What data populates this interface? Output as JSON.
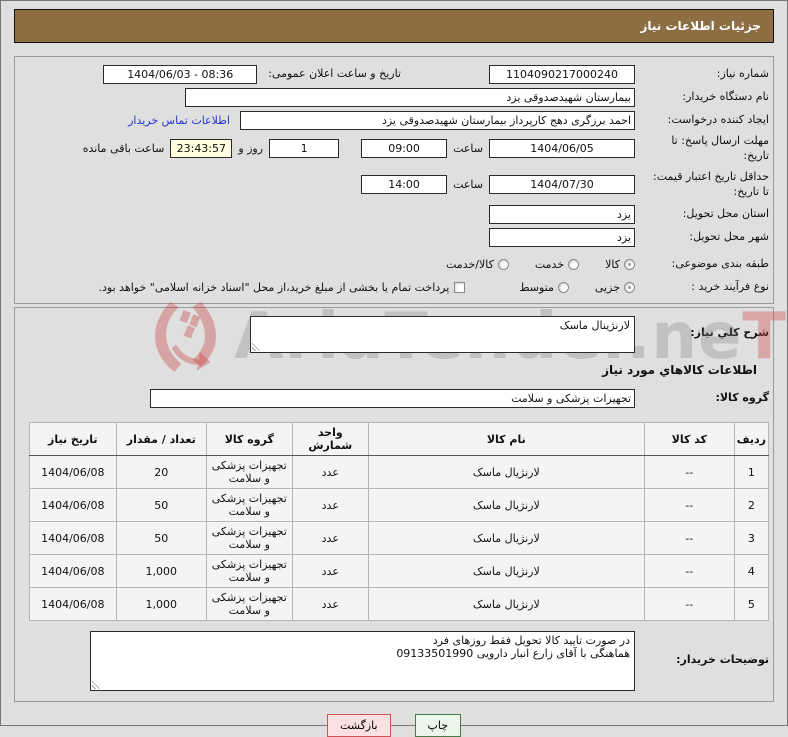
{
  "header": {
    "title": "جزئیات اطلاعات نیاز"
  },
  "colors": {
    "titlebar_bg": "#8d6e42",
    "countdown_bg": "#ffffe0",
    "link": "#2a35c8",
    "print_button_bg": "#e9f6e9",
    "print_button_border": "#4a7a4a",
    "back_button_bg": "#fbe1e1",
    "back_button_border": "#cc5555"
  },
  "watermark": {
    "text": "AriaTender.ne",
    "suffix": "T"
  },
  "form": {
    "need_number": {
      "label": "شماره نیاز:",
      "value": "1104090217000240"
    },
    "announce": {
      "label": "تاریخ و ساعت اعلان عمومی:",
      "value": "1404/06/03 - 08:36"
    },
    "buyer_org": {
      "label": "نام دستگاه خریدار:",
      "value": "بیمارستان شهیدصدوقی یزد"
    },
    "creator": {
      "label": "ایجاد کننده درخواست:",
      "value": "احمد برزگری دهج کارپرداز بیمارستان شهیدصدوقی یزد",
      "contact_link": "اطلاعات تماس خریدار"
    },
    "deadline": {
      "label": "مهلت ارسال پاسخ: تا\nتاریخ:",
      "date": "1404/06/05",
      "time_label": "ساعت",
      "time": "09:00",
      "days_value": "1",
      "days_label": "روز و",
      "countdown": "23:43:57",
      "countdown_label": "ساعت باقی مانده"
    },
    "validity": {
      "label": "حداقل تاریخ اعتبار قیمت:\nتا تاریخ:",
      "date": "1404/07/30",
      "time_label": "ساعت",
      "time": "14:00"
    },
    "province": {
      "label": "استان محل تحویل:",
      "value": "یزد"
    },
    "city": {
      "label": "شهر محل تحویل:",
      "value": "یزد"
    },
    "category": {
      "label": "طبقه بندی موضوعی:",
      "options": [
        "کالا",
        "خدمت",
        "کالا/خدمت"
      ],
      "selected": "کالا"
    },
    "process": {
      "label": "نوع فرآیند خرید :",
      "options": [
        "جزیی",
        "متوسط"
      ],
      "selected": "جزیی",
      "checkbox_label": "پرداخت تمام یا بخشی از مبلغ خرید،از محل \"اسناد خزانه اسلامی\" خواهد بود.",
      "checkbox_checked": false
    }
  },
  "description": {
    "label": "شرح کلي نیاز:",
    "value": "لارنژینال ماسک"
  },
  "items_section": {
    "title": "اطلاعات کالاهاي مورد نیاز",
    "group": {
      "label": "گروه کالا:",
      "value": "تجهیزات پزشکی و سلامت"
    },
    "table": {
      "headers": [
        "ردیف",
        "کد کالا",
        "نام کالا",
        "واحد شمارش",
        "گروه کالا",
        "تعداد / مقدار",
        "تاریخ نیاز"
      ],
      "rows": [
        [
          "1",
          "--",
          "لارنژیال ماسک",
          "عدد",
          "تجهیزات پزشکی و سلامت",
          "20",
          "1404/06/08"
        ],
        [
          "2",
          "--",
          "لارنژیال ماسک",
          "عدد",
          "تجهیزات پزشکی و سلامت",
          "50",
          "1404/06/08"
        ],
        [
          "3",
          "--",
          "لارنژیال ماسک",
          "عدد",
          "تجهیزات پزشکی و سلامت",
          "50",
          "1404/06/08"
        ],
        [
          "4",
          "--",
          "لارنژیال ماسک",
          "عدد",
          "تجهیزات پزشکی و سلامت",
          "1,000",
          "1404/06/08"
        ],
        [
          "5",
          "--",
          "لارنژیال ماسک",
          "عدد",
          "تجهیزات پزشکی و سلامت",
          "1,000",
          "1404/06/08"
        ]
      ]
    }
  },
  "buyer_notes": {
    "label": "توضیحات خریدار:",
    "value": "در صورت تایید کالا تحویل فقط روزهای فرد\nهماهنگی با آقای زارع انبار دارویی 09133501990"
  },
  "buttons": {
    "print": "چاپ",
    "back": "بازگشت"
  }
}
